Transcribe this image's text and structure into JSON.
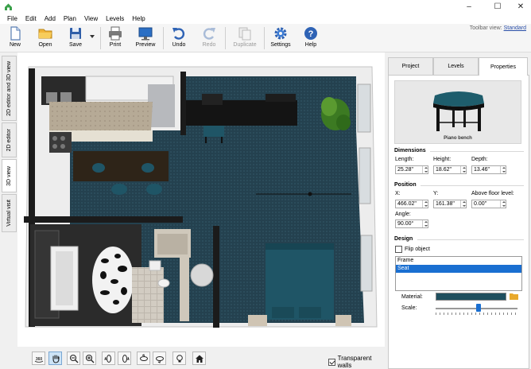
{
  "window": {
    "minimize": "–",
    "maximize": "☐",
    "close": "✕"
  },
  "menu": [
    "File",
    "Edit",
    "Add",
    "Plan",
    "View",
    "Levels",
    "Help"
  ],
  "toolbar": {
    "new": "New",
    "open": "Open",
    "save": "Save",
    "print": "Print",
    "preview": "Preview",
    "undo": "Undo",
    "redo": "Redo",
    "duplicate": "Duplicate",
    "settings": "Settings",
    "help": "Help",
    "view_label": "Toolbar view:",
    "view_value": "Standard"
  },
  "left_tabs": [
    "2D editor and 3D view",
    "2D editor",
    "3D view",
    "Virtual visit"
  ],
  "active_left_tab": "3D view",
  "bottom": {
    "transparent_walls": "Transparent walls",
    "transparent_checked": true,
    "icons": [
      "rotate-360-icon",
      "pan-hand-icon",
      "zoom-out-icon",
      "zoom-in-icon",
      "rotate-left-icon",
      "rotate-right-icon",
      "tilt-up-icon",
      "tilt-down-icon",
      "light-bulb-icon",
      "home-icon"
    ]
  },
  "right_tabs": [
    "Project",
    "Levels",
    "Properties"
  ],
  "active_right_tab": "Properties",
  "properties": {
    "object_name": "Piano bench",
    "dimensions_title": "Dimensions",
    "length_label": "Length:",
    "length_value": "25.28\"",
    "height_label": "Height:",
    "height_value": "18.62\"",
    "depth_label": "Depth:",
    "depth_value": "13.46\"",
    "position_title": "Position",
    "x_label": "X:",
    "x_value": "466.02\"",
    "y_label": "Y:",
    "y_value": "161.38\"",
    "floor_label": "Above floor level:",
    "floor_value": "0.00\"",
    "angle_label": "Angle:",
    "angle_value": "90.00°",
    "design_title": "Design",
    "flip_label": "Flip object",
    "flip_checked": false,
    "parts": [
      "Frame",
      "Seat"
    ],
    "selected_part": "Seat",
    "material_label": "Material:",
    "material_color": "#1f4f5e",
    "scale_label": "Scale:",
    "scale_level": 0.52
  },
  "colors": {
    "accent": "#1a6fd1",
    "floor": "#24414f",
    "bed": "#1f5566"
  }
}
